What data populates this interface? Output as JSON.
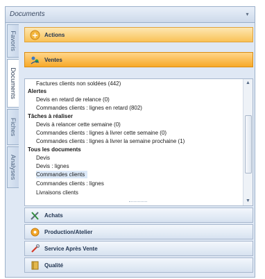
{
  "window": {
    "title": "Documents"
  },
  "side_tabs": [
    "Favoris",
    "Documents",
    "Fiches",
    "Analyses"
  ],
  "sections": {
    "actions": "Actions",
    "ventes": "Ventes",
    "achats": "Achats",
    "production": "Production/Atelier",
    "sav": "Service Après Vente",
    "qualite": "Qualité"
  },
  "list": {
    "r0": "Factures clients non soldées (442)",
    "r1": "Alertes",
    "r2": "Devis en retard de relance (0)",
    "r3": "Commandes clients : lignes en retard (802)",
    "r4": "Tâches à réaliser",
    "r5": "Devis à relancer cette semaine (0)",
    "r6": "Commandes clients : lignes à livrer cette semaine (0)",
    "r7": "Commandes clients : lignes à livrer la semaine prochaine (1)",
    "r8": "Tous les documents",
    "r9": "Devis",
    "r10": "Devis : lignes",
    "r11": "Commandes clients",
    "r12": "Commandes clients : lignes",
    "r13": "Livraisons clients"
  },
  "icons": {
    "pin": "pin-icon",
    "actions": "folder-icon",
    "ventes": "people-arrows-icon",
    "achats": "tools-icon",
    "production": "gear-icon",
    "sav": "wrench-icon",
    "qualite": "book-icon"
  },
  "colors": {
    "accent": "#f9c257",
    "selected_row": "#dce9f8"
  }
}
